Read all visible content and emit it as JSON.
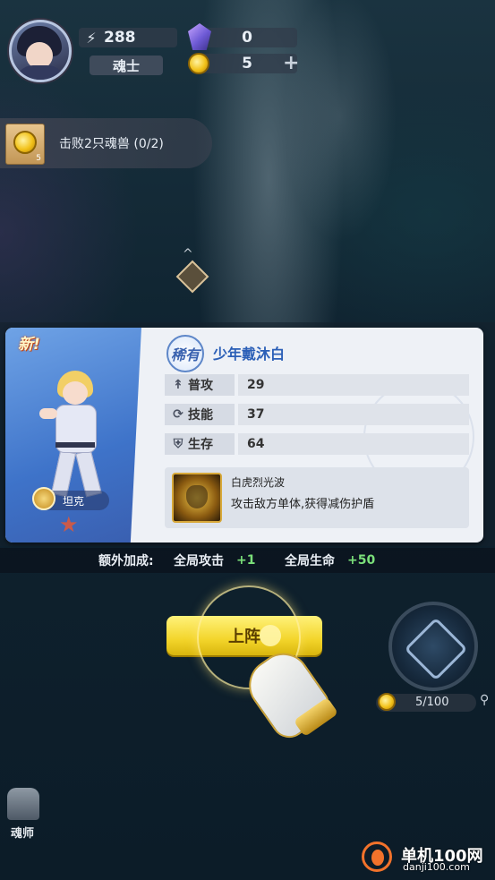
{
  "player": {
    "power": "288",
    "rank": "魂士",
    "gems": "0",
    "coins": "5",
    "add_symbol": "+"
  },
  "quest": {
    "reward_count": "5",
    "text": "击败2只魂兽 (0/2)"
  },
  "card": {
    "new_tag": "新!",
    "rarity": "稀有",
    "hero_name": "少年戴沐白",
    "role": "坦克",
    "stats": [
      {
        "label": "普攻",
        "value": "29",
        "icon": "attack-icon"
      },
      {
        "label": "技能",
        "value": "37",
        "icon": "skill-cycle-icon"
      },
      {
        "label": "生存",
        "value": "64",
        "icon": "shield-icon"
      }
    ],
    "skill": {
      "name": "白虎烈光波",
      "description": "攻击敌方单体,获得减伤护盾"
    }
  },
  "bonus": {
    "label": "额外加成:",
    "attack_label": "全局攻击",
    "attack_value": "+1",
    "life_label": "全局生命",
    "life_value": "+50"
  },
  "deploy_button": "上阵",
  "orb": {
    "progress_text": "5/100"
  },
  "class_label": "魂师",
  "watermark": {
    "name": "单机100网",
    "url": "danji100.com"
  },
  "colors": {
    "accent_yellow": "#f3d52b",
    "bonus_green": "#7be07a",
    "card_blue": "#3e73c9"
  }
}
